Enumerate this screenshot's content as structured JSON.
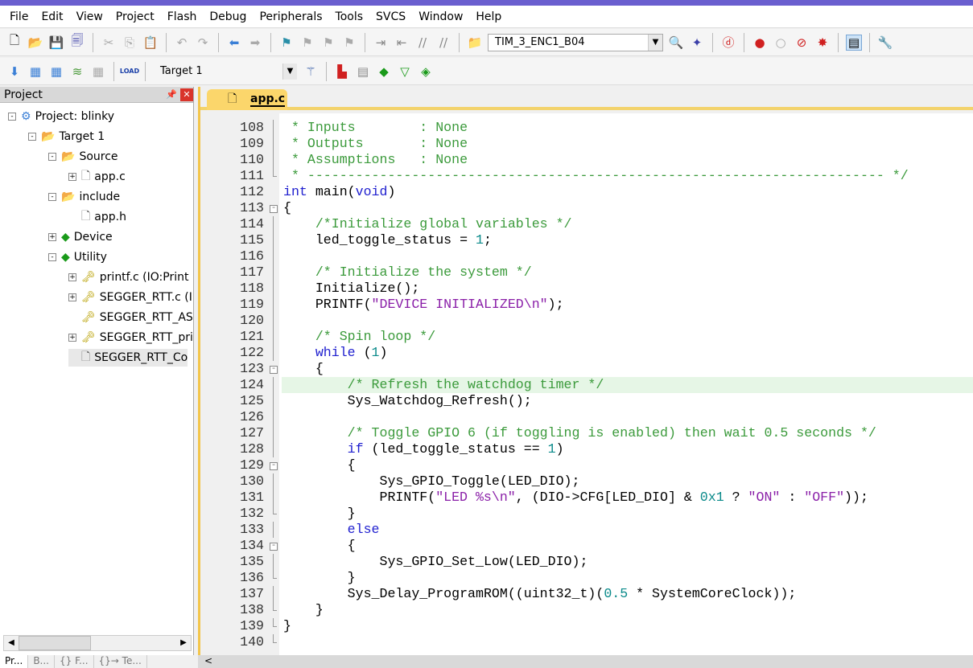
{
  "menu": [
    "File",
    "Edit",
    "View",
    "Project",
    "Flash",
    "Debug",
    "Peripherals",
    "Tools",
    "SVCS",
    "Window",
    "Help"
  ],
  "toolbar1": {
    "config_combo": "TIM_3_ENC1_B04"
  },
  "toolbar2": {
    "target_combo": "Target 1",
    "load_label": "LOAD"
  },
  "project_panel": {
    "title": "Project",
    "tree": [
      {
        "label": "Project: blinky",
        "level": 0,
        "exp": "-",
        "icon": "project-icon"
      },
      {
        "label": "Target 1",
        "level": 1,
        "exp": "-",
        "icon": "target-icon"
      },
      {
        "label": "Source",
        "level": 2,
        "exp": "-",
        "icon": "folder-icon"
      },
      {
        "label": "app.c",
        "level": 3,
        "exp": "+",
        "icon": "file-icon"
      },
      {
        "label": "include",
        "level": 2,
        "exp": "-",
        "icon": "folder-icon"
      },
      {
        "label": "app.h",
        "level": 3,
        "exp": "",
        "icon": "file-icon"
      },
      {
        "label": "Device",
        "level": 2,
        "exp": "+",
        "icon": "component-icon"
      },
      {
        "label": "Utility",
        "level": 2,
        "exp": "-",
        "icon": "component-icon"
      },
      {
        "label": "printf.c (IO:Print",
        "level": 3,
        "exp": "+",
        "icon": "key-file-icon"
      },
      {
        "label": "SEGGER_RTT.c (I",
        "level": 3,
        "exp": "+",
        "icon": "key-file-icon"
      },
      {
        "label": "SEGGER_RTT_AS",
        "level": 3,
        "exp": "",
        "icon": "key-file-icon"
      },
      {
        "label": "SEGGER_RTT_pri",
        "level": 3,
        "exp": "+",
        "icon": "key-file-icon"
      },
      {
        "label": "SEGGER_RTT_Co",
        "level": 3,
        "exp": "",
        "icon": "file-icon"
      }
    ],
    "bottom_tabs": [
      "Pr...",
      "B...",
      "{} F...",
      "{}→ Te..."
    ]
  },
  "editor": {
    "tab": "app.c",
    "highlight_line": 124,
    "lines": [
      {
        "n": 108,
        "t": " * Inputs        : None",
        "f": "|"
      },
      {
        "n": 109,
        "t": " * Outputs       : None",
        "f": "|"
      },
      {
        "n": 110,
        "t": " * Assumptions   : None",
        "f": "|"
      },
      {
        "n": 111,
        "t": " * ------------------------------------------------------------------------ */",
        "f": "L"
      },
      {
        "n": 112,
        "t": "int main(void)",
        "f": ""
      },
      {
        "n": 113,
        "t": "{",
        "f": "-"
      },
      {
        "n": 114,
        "t": "    /*Initialize global variables */",
        "f": "|"
      },
      {
        "n": 115,
        "t": "    led_toggle_status = 1;",
        "f": "|"
      },
      {
        "n": 116,
        "t": "",
        "f": "|"
      },
      {
        "n": 117,
        "t": "    /* Initialize the system */",
        "f": "|"
      },
      {
        "n": 118,
        "t": "    Initialize();",
        "f": "|"
      },
      {
        "n": 119,
        "t": "    PRINTF(\"DEVICE INITIALIZED\\n\");",
        "f": "|"
      },
      {
        "n": 120,
        "t": "",
        "f": "|"
      },
      {
        "n": 121,
        "t": "    /* Spin loop */",
        "f": "|"
      },
      {
        "n": 122,
        "t": "    while (1)",
        "f": "|"
      },
      {
        "n": 123,
        "t": "    {",
        "f": "-"
      },
      {
        "n": 124,
        "t": "        /* Refresh the watchdog timer */",
        "f": "|"
      },
      {
        "n": 125,
        "t": "        Sys_Watchdog_Refresh();",
        "f": "|"
      },
      {
        "n": 126,
        "t": "",
        "f": "|"
      },
      {
        "n": 127,
        "t": "        /* Toggle GPIO 6 (if toggling is enabled) then wait 0.5 seconds */",
        "f": "|"
      },
      {
        "n": 128,
        "t": "        if (led_toggle_status == 1)",
        "f": "|"
      },
      {
        "n": 129,
        "t": "        {",
        "f": "-"
      },
      {
        "n": 130,
        "t": "            Sys_GPIO_Toggle(LED_DIO);",
        "f": "|"
      },
      {
        "n": 131,
        "t": "            PRINTF(\"LED %s\\n\", (DIO->CFG[LED_DIO] & 0x1 ? \"ON\" : \"OFF\"));",
        "f": "|"
      },
      {
        "n": 132,
        "t": "        }",
        "f": "L"
      },
      {
        "n": 133,
        "t": "        else",
        "f": "|"
      },
      {
        "n": 134,
        "t": "        {",
        "f": "-"
      },
      {
        "n": 135,
        "t": "            Sys_GPIO_Set_Low(LED_DIO);",
        "f": "|"
      },
      {
        "n": 136,
        "t": "        }",
        "f": "L"
      },
      {
        "n": 137,
        "t": "        Sys_Delay_ProgramROM((uint32_t)(0.5 * SystemCoreClock));",
        "f": "|"
      },
      {
        "n": 138,
        "t": "    }",
        "f": "L"
      },
      {
        "n": 139,
        "t": "}",
        "f": "L"
      },
      {
        "n": 140,
        "t": "",
        "f": "L"
      }
    ]
  },
  "colors": {
    "comment": "#3b9a3b",
    "keyword": "#1f1fcf",
    "string": "#8a1fa8",
    "number": "#0a8a8a",
    "tab": "#fbd66b",
    "highlight": "#e6f6e6"
  }
}
